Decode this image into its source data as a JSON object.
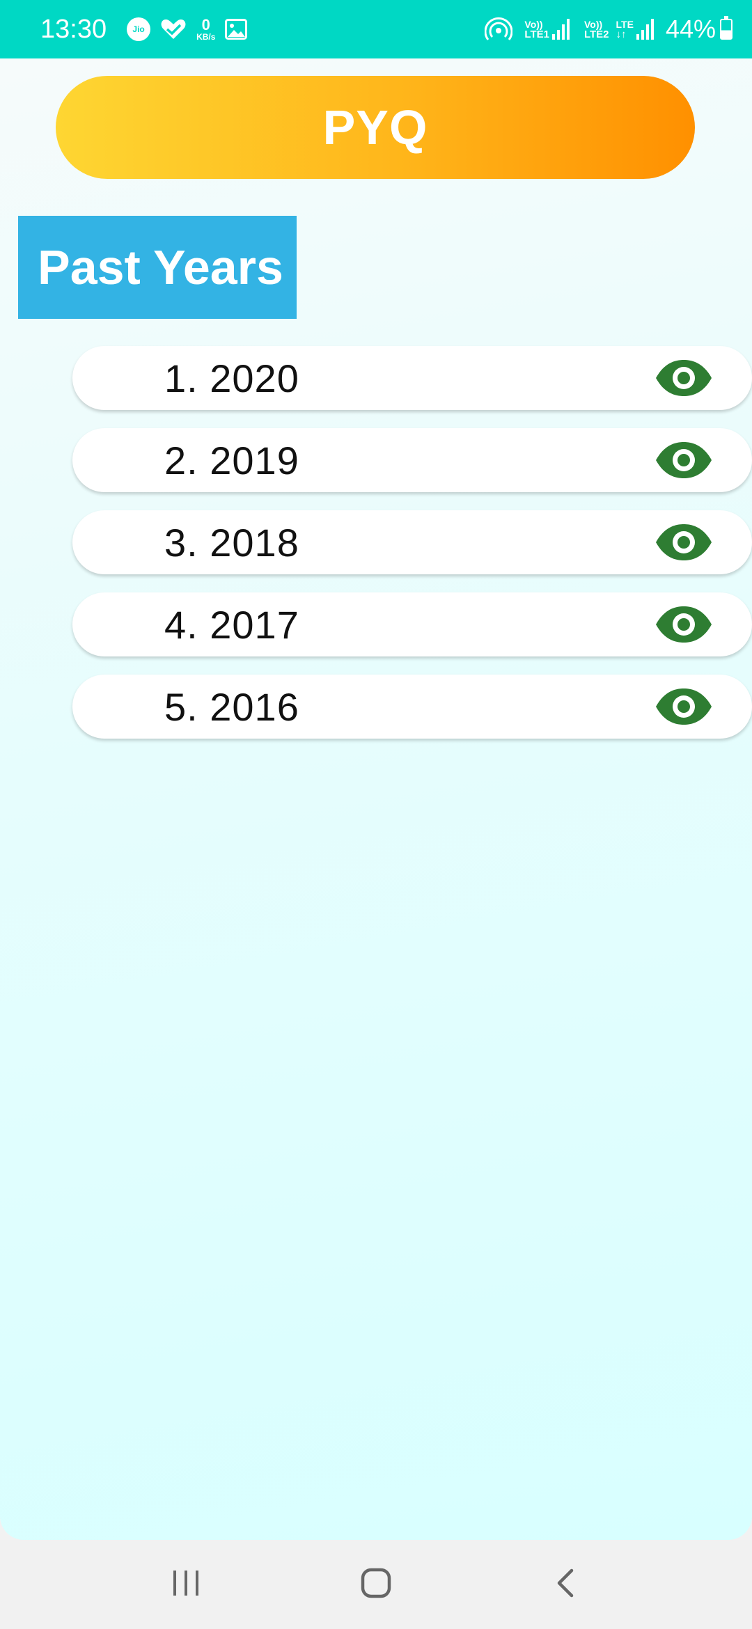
{
  "status_bar": {
    "time": "13:30",
    "carrier_badge": "Jio",
    "speed_value": "0",
    "speed_unit": "KB/s",
    "sim1_top": "Vo))",
    "sim1_bottom": "LTE1",
    "sim2_top": "Vo))",
    "sim2_bottom": "LTE2",
    "data_label": "LTE",
    "battery_percent": "44%",
    "battery_level": 0.44,
    "background_color": "#00d8c4"
  },
  "header": {
    "title": "PYQ",
    "gradient_colors": [
      "#fed632",
      "#ff9000"
    ]
  },
  "section": {
    "title": "Past Years",
    "background_color": "#33b3e4"
  },
  "years": [
    {
      "label": "1. 2020",
      "action_icon": "eye-icon"
    },
    {
      "label": "2. 2019",
      "action_icon": "eye-icon"
    },
    {
      "label": "3. 2018",
      "action_icon": "eye-icon"
    },
    {
      "label": "4. 2017",
      "action_icon": "eye-icon"
    },
    {
      "label": "5. 2016",
      "action_icon": "eye-icon"
    }
  ],
  "icon_color": "#2e7d32",
  "nav_bar": {
    "recent_icon": "recent-apps-icon",
    "home_icon": "home-icon",
    "back_icon": "back-icon"
  }
}
